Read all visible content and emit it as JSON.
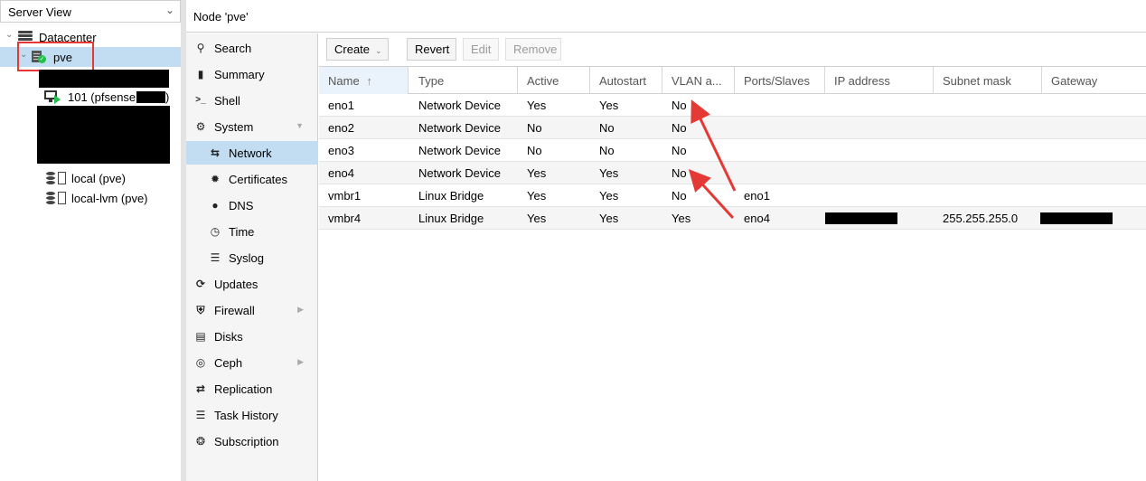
{
  "tree": {
    "view_selector": "Server View",
    "datacenter": "Datacenter",
    "node": "pve",
    "vm": "101 (pfsense",
    "vm_suffix": ")",
    "storages": [
      "local (pve)",
      "local-lvm (pve)"
    ]
  },
  "header": {
    "title": "Node 'pve'"
  },
  "nav": {
    "items": [
      {
        "label": "Search",
        "icon": "search-icon"
      },
      {
        "label": "Summary",
        "icon": "book-icon"
      },
      {
        "label": "Shell",
        "icon": "terminal-icon"
      },
      {
        "label": "System",
        "icon": "cogs-icon"
      },
      {
        "label": "Network",
        "icon": "exchange-icon"
      },
      {
        "label": "Certificates",
        "icon": "certificate-icon"
      },
      {
        "label": "DNS",
        "icon": "globe-icon"
      },
      {
        "label": "Time",
        "icon": "clock-icon"
      },
      {
        "label": "Syslog",
        "icon": "list-icon"
      },
      {
        "label": "Updates",
        "icon": "refresh-icon"
      },
      {
        "label": "Firewall",
        "icon": "shield-icon"
      },
      {
        "label": "Disks",
        "icon": "hdd-icon"
      },
      {
        "label": "Ceph",
        "icon": "ceph-icon"
      },
      {
        "label": "Replication",
        "icon": "retweet-icon"
      },
      {
        "label": "Task History",
        "icon": "list-alt-icon"
      },
      {
        "label": "Subscription",
        "icon": "support-icon"
      }
    ]
  },
  "toolbar": {
    "create": "Create",
    "revert": "Revert",
    "edit": "Edit",
    "remove": "Remove"
  },
  "grid": {
    "columns": [
      "Name",
      "Type",
      "Active",
      "Autostart",
      "VLAN a...",
      "Ports/Slaves",
      "IP address",
      "Subnet mask",
      "Gateway"
    ],
    "sort_indicator": "↑",
    "rows": [
      {
        "name": "eno1",
        "type": "Network Device",
        "active": "Yes",
        "autostart": "Yes",
        "vlan": "No",
        "ports": "",
        "ip": "",
        "mask": "",
        "gateway": ""
      },
      {
        "name": "eno2",
        "type": "Network Device",
        "active": "No",
        "autostart": "No",
        "vlan": "No",
        "ports": "",
        "ip": "",
        "mask": "",
        "gateway": ""
      },
      {
        "name": "eno3",
        "type": "Network Device",
        "active": "No",
        "autostart": "No",
        "vlan": "No",
        "ports": "",
        "ip": "",
        "mask": "",
        "gateway": ""
      },
      {
        "name": "eno4",
        "type": "Network Device",
        "active": "Yes",
        "autostart": "Yes",
        "vlan": "No",
        "ports": "",
        "ip": "",
        "mask": "",
        "gateway": ""
      },
      {
        "name": "vmbr1",
        "type": "Linux Bridge",
        "active": "Yes",
        "autostart": "Yes",
        "vlan": "No",
        "ports": "eno1",
        "ip": "",
        "mask": "",
        "gateway": ""
      },
      {
        "name": "vmbr4",
        "type": "Linux Bridge",
        "active": "Yes",
        "autostart": "Yes",
        "vlan": "Yes",
        "ports": "eno4",
        "ip": "",
        "mask": "255.255.255.0",
        "gateway": ""
      }
    ]
  },
  "colors": {
    "selection": "#c2ddf2",
    "annotation_red": "#e53935",
    "status_green": "#21bf4b"
  }
}
